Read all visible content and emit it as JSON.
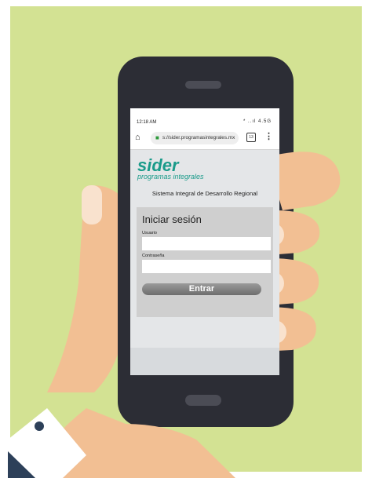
{
  "status": {
    "time": "12:18 AM",
    "icons": "* ..ıl 4.5G"
  },
  "browser": {
    "url": "s://sider.programasintegrales.mx",
    "tab_count": "13"
  },
  "brand": {
    "name": "sider",
    "tagline": "programas integrales"
  },
  "subtitle": "Sistema Integral de Desarrollo Regional",
  "login": {
    "title": "Iniciar sesión",
    "user_label": "Usuario",
    "password_label": "Contraseña",
    "submit_label": "Entrar"
  },
  "colors": {
    "background": "#d3e293",
    "brand": "#1a9b8a",
    "phone": "#2c2d35",
    "skin": "#f2bf93"
  }
}
